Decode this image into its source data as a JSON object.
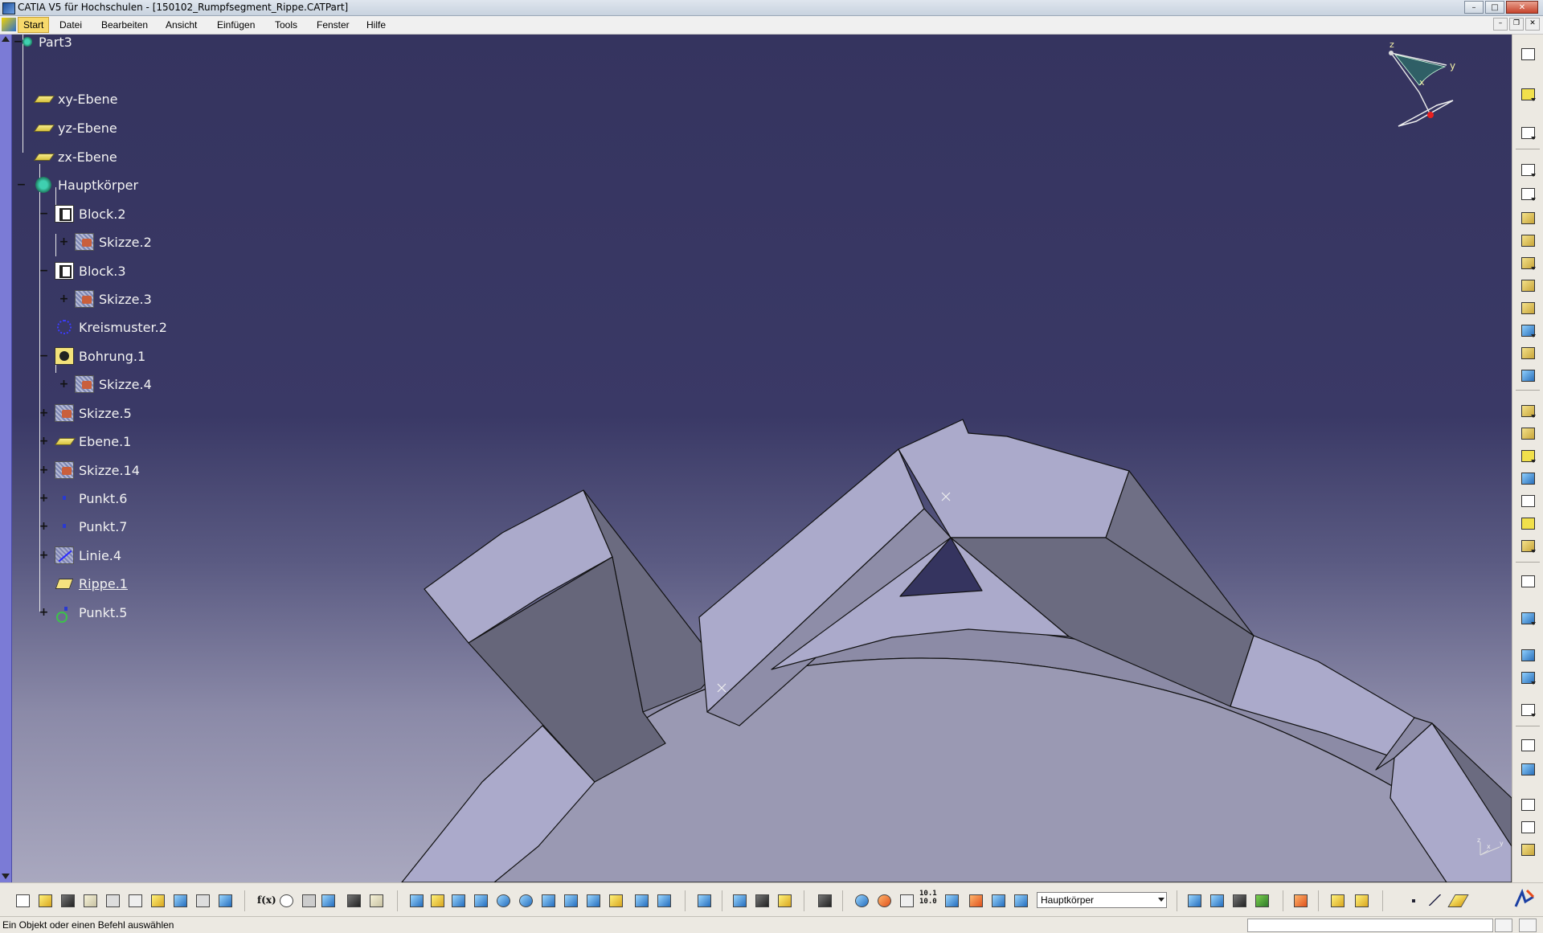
{
  "window": {
    "title": "CATIA V5 für Hochschulen - [150102_Rumpfsegment_Rippe.CATPart]"
  },
  "menu": {
    "items": [
      "Start",
      "Datei",
      "Bearbeiten",
      "Ansicht",
      "Einfügen",
      "Tools",
      "Fenster",
      "Hilfe"
    ],
    "active": "Start"
  },
  "tree": {
    "root": "Part3",
    "nodes": [
      {
        "label": "xy-Ebene",
        "icon": "plane-icon"
      },
      {
        "label": "yz-Ebene",
        "icon": "plane-icon"
      },
      {
        "label": "zx-Ebene",
        "icon": "plane-icon"
      },
      {
        "label": "Hauptkörper",
        "icon": "body-icon"
      },
      {
        "label": "Block.2",
        "icon": "pad-icon"
      },
      {
        "label": "Skizze.2",
        "icon": "sketch-icon"
      },
      {
        "label": "Block.3",
        "icon": "pad-icon"
      },
      {
        "label": "Skizze.3",
        "icon": "sketch-icon"
      },
      {
        "label": "Kreismuster.2",
        "icon": "circular-pattern-icon"
      },
      {
        "label": "Bohrung.1",
        "icon": "hole-icon"
      },
      {
        "label": "Skizze.4",
        "icon": "sketch-icon"
      },
      {
        "label": "Skizze.5",
        "icon": "sketch-icon"
      },
      {
        "label": "Ebene.1",
        "icon": "plane-icon"
      },
      {
        "label": "Skizze.14",
        "icon": "sketch-icon"
      },
      {
        "label": "Punkt.6",
        "icon": "point-icon"
      },
      {
        "label": "Punkt.7",
        "icon": "point-icon"
      },
      {
        "label": "Linie.4",
        "icon": "line-icon"
      },
      {
        "label": "Rippe.1",
        "icon": "rib-icon",
        "underlined": true
      },
      {
        "label": "Punkt.5",
        "icon": "point-icon"
      }
    ]
  },
  "compass": {
    "axes": [
      "z",
      "y",
      "x"
    ],
    "mini_axes": [
      "z",
      "y",
      "x"
    ]
  },
  "toolbar": {
    "current_body": "Hauptkörper",
    "zoom_readout": "10.1\n10.0",
    "formula_label": "f(x)"
  },
  "status": {
    "message": "Ein Objekt oder einen Befehl auswählen"
  },
  "colors": {
    "viewport_top": "#35345f",
    "viewport_bottom": "#a9a8bf",
    "part_light": "#abaacb",
    "part_dark": "#6b6b80",
    "tree_text": "#f2f2f2",
    "tree_strip": "#7b7bd6"
  }
}
